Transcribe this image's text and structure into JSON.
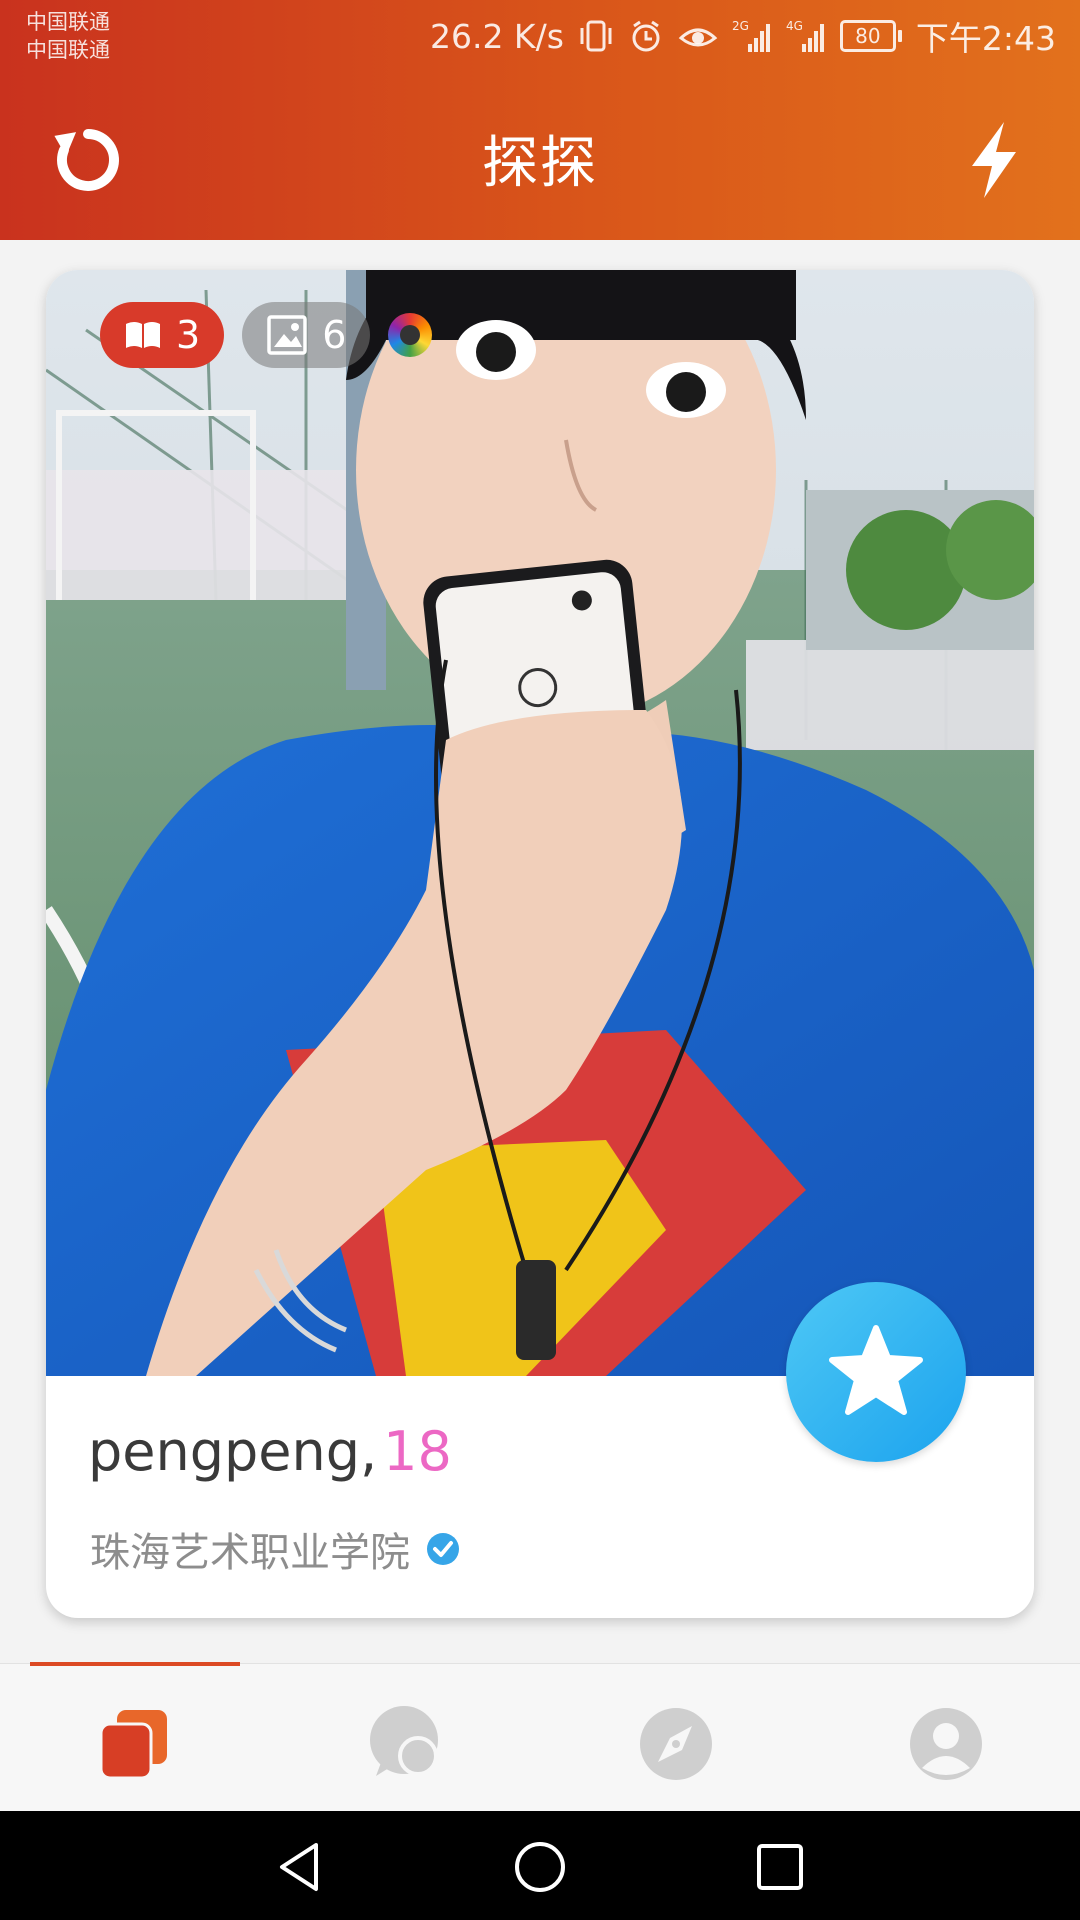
{
  "status_bar": {
    "carrier_1": "中国联通",
    "carrier_2": "中国联通",
    "net_speed": "26.2 K/s",
    "signal_1_label": "2G",
    "signal_2_label": "4G",
    "battery": "80",
    "time": "下午2:43",
    "icons": [
      "vibrate-icon",
      "alarm-icon",
      "eye-icon",
      "signal-icon",
      "signal-icon",
      "battery-icon"
    ]
  },
  "header": {
    "title": "探探",
    "left_icon": "refresh-icon",
    "right_icon": "lightning-icon"
  },
  "card": {
    "badges": {
      "moments_count": "3",
      "photos_count": "6"
    },
    "name": "pengpeng,",
    "age": "18",
    "school": "珠海艺术职业学院",
    "super_like_icon": "star-icon"
  },
  "bottom_nav": {
    "active_index": 0,
    "items": [
      "cards-icon",
      "chat-icon",
      "compass-icon",
      "profile-icon"
    ]
  },
  "colors": {
    "header_start": "#c9321e",
    "header_end": "#e2711c",
    "accent": "#dc4a24",
    "age": "#ec68c4",
    "super_like": "#1ca3ee",
    "verified": "#36a5e8"
  }
}
